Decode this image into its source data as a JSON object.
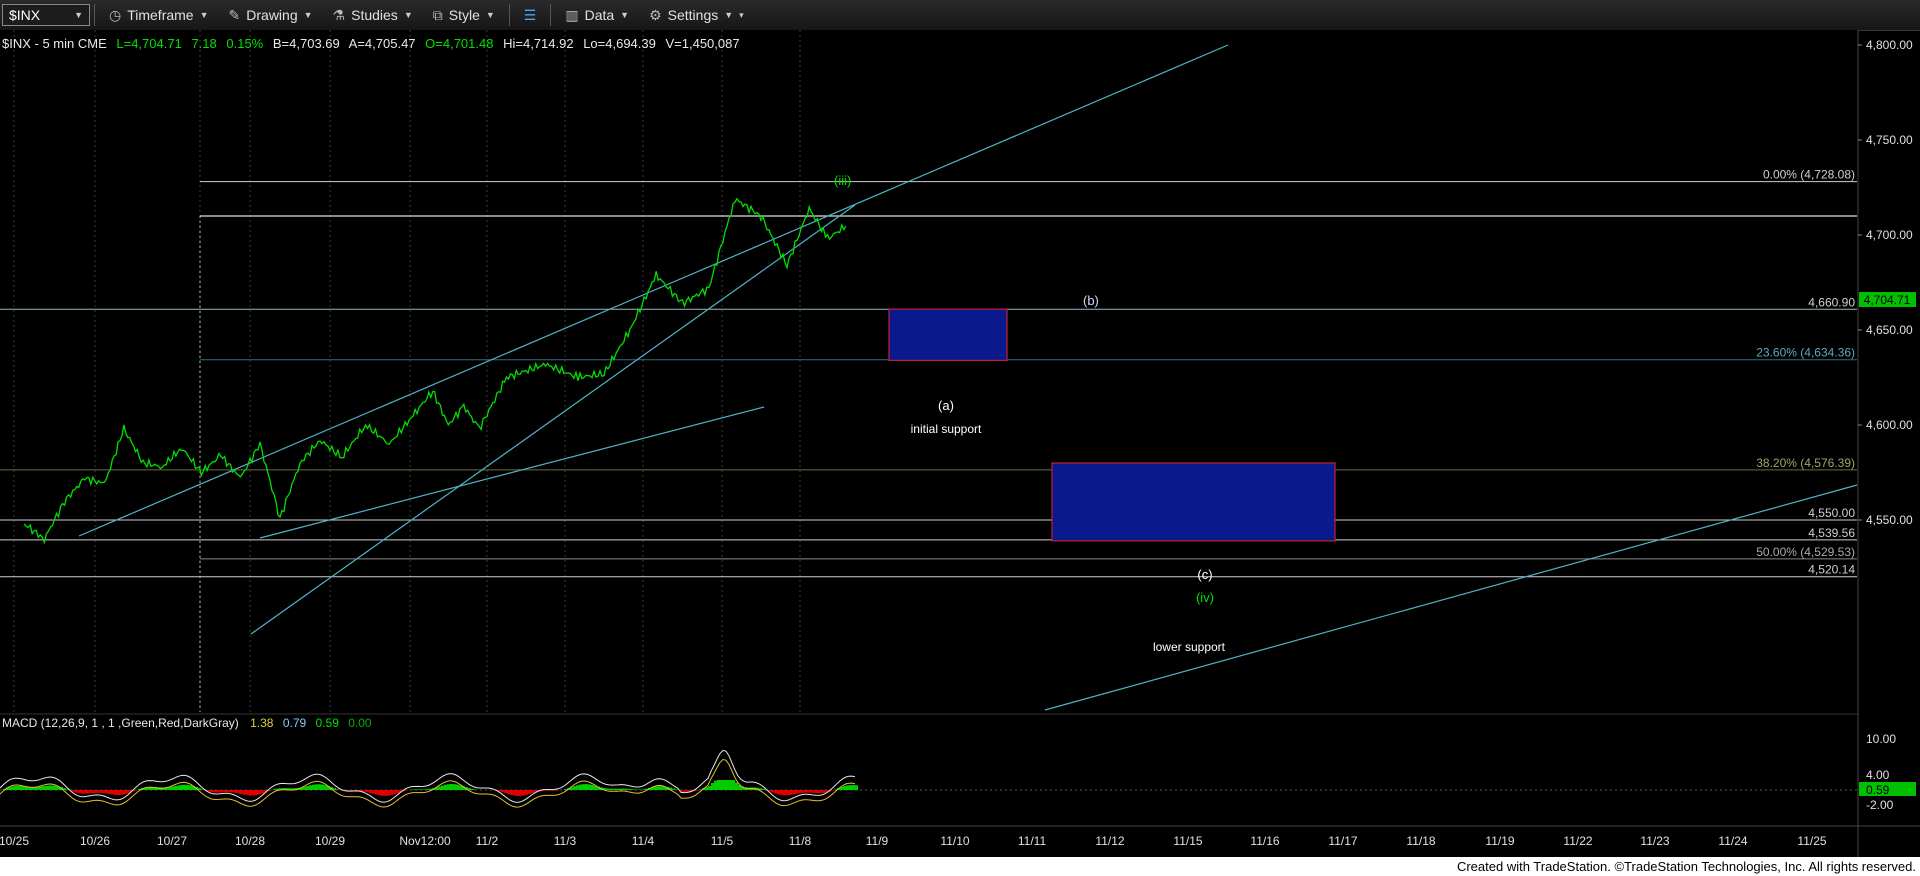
{
  "toolbar": {
    "symbol": "$INX",
    "timeframe": "Timeframe",
    "drawing": "Drawing",
    "studies": "Studies",
    "style": "Style",
    "data": "Data",
    "settings": "Settings"
  },
  "status_line": {
    "symbol": "$INX - 5 min  CME",
    "last": "L=4,704.71",
    "change": "7.18",
    "change_pct": "0.15%",
    "bid": "B=4,703.69",
    "ask": "A=4,705.47",
    "open": "O=4,701.48",
    "high": "Hi=4,714.92",
    "low": "Lo=4,694.39",
    "volume": "V=1,450,087"
  },
  "colors": {
    "price": "#00e000",
    "channel": "#4fb3c8",
    "box_fill": "#0a1a8c",
    "box_border": "#c0203a",
    "macd_up": "#00cc00",
    "macd_down": "#dd0000"
  },
  "chart_data": {
    "type": "line",
    "title": "",
    "y_axis_ticks": [
      "4,800.00",
      "4,750.00",
      "4,700.00",
      "4,650.00",
      "4,600.00",
      "4,550.00"
    ],
    "ylim": [
      4515,
      4805
    ],
    "x_axis_ticks": [
      "10/25",
      "10/26",
      "10/27",
      "10/28",
      "10/29",
      "Nov12:00",
      "11/2",
      "11/3",
      "11/4",
      "11/5",
      "11/8",
      "11/9",
      "11/10",
      "11/11",
      "11/12",
      "11/15",
      "11/16",
      "11/17",
      "11/18",
      "11/19",
      "11/22",
      "11/23",
      "11/24",
      "11/25"
    ],
    "last_price_label": "4,704.71",
    "levels": [
      {
        "label": "0.00% (4,728.08)",
        "value": 4728.08
      },
      {
        "label": "4,660.90",
        "value": 4660.9
      },
      {
        "label": "23.60% (4,634.36)",
        "value": 4634.36
      },
      {
        "label": "38.20% (4,576.39)",
        "value": 4576.39
      },
      {
        "label": "4,550.00",
        "value": 4550.0
      },
      {
        "label": "4,539.56",
        "value": 4539.56
      },
      {
        "label": "50.00% (4,529.53)",
        "value": 4529.53
      },
      {
        "label": "4,520.14",
        "value": 4520.14
      }
    ],
    "price_series": [
      {
        "x": "10/25",
        "y": 4548
      },
      {
        "x": "10/25",
        "y": 4540
      },
      {
        "x": "10/25",
        "y": 4560
      },
      {
        "x": "10/25",
        "y": 4572
      },
      {
        "x": "10/26",
        "y": 4569
      },
      {
        "x": "10/26",
        "y": 4598
      },
      {
        "x": "10/26",
        "y": 4580
      },
      {
        "x": "10/26",
        "y": 4578
      },
      {
        "x": "10/27",
        "y": 4588
      },
      {
        "x": "10/27",
        "y": 4575
      },
      {
        "x": "10/27",
        "y": 4584
      },
      {
        "x": "10/27",
        "y": 4572
      },
      {
        "x": "10/28",
        "y": 4590
      },
      {
        "x": "10/28",
        "y": 4551
      },
      {
        "x": "10/28",
        "y": 4580
      },
      {
        "x": "10/28",
        "y": 4592
      },
      {
        "x": "10/29",
        "y": 4583
      },
      {
        "x": "10/29",
        "y": 4600
      },
      {
        "x": "10/29",
        "y": 4590
      },
      {
        "x": "10/29",
        "y": 4605
      },
      {
        "x": "Nov12:00",
        "y": 4618
      },
      {
        "x": "Nov12:00",
        "y": 4600
      },
      {
        "x": "Nov12:00",
        "y": 4610
      },
      {
        "x": "Nov12:00",
        "y": 4598
      },
      {
        "x": "11/2",
        "y": 4625
      },
      {
        "x": "11/2",
        "y": 4632
      },
      {
        "x": "11/3",
        "y": 4625
      },
      {
        "x": "11/3",
        "y": 4627
      },
      {
        "x": "11/3",
        "y": 4650
      },
      {
        "x": "11/4",
        "y": 4679
      },
      {
        "x": "11/4",
        "y": 4664
      },
      {
        "x": "11/4",
        "y": 4672
      },
      {
        "x": "11/5",
        "y": 4719
      },
      {
        "x": "11/5",
        "y": 4710
      },
      {
        "x": "11/5",
        "y": 4684
      },
      {
        "x": "11/8",
        "y": 4714
      },
      {
        "x": "11/8",
        "y": 4698
      },
      {
        "x": "11/8",
        "y": 4704.71
      }
    ],
    "annotations": [
      {
        "text": "(iii)",
        "color": "#00e000"
      },
      {
        "text": "(b)",
        "color": "#cfd8ff"
      },
      {
        "text": "(a)",
        "color": "#ffffff"
      },
      {
        "text": "initial support",
        "color": "#ffffff"
      },
      {
        "text": "(c)",
        "color": "#ffffff"
      },
      {
        "text": "(iv)",
        "color": "#00e000"
      },
      {
        "text": "lower support",
        "color": "#ffffff"
      }
    ]
  },
  "macd": {
    "label": "MACD (12,26,9, 1 , 1 ,Green,Red,DarkGray)",
    "v1": "1.38",
    "v2": "0.79",
    "v3": "0.59",
    "v4": "0.00",
    "axis_ticks": [
      "10.00",
      "4.00",
      "0.59",
      "-2.00"
    ]
  },
  "footer": "Created with TradeStation. ©TradeStation Technologies, Inc. All rights reserved."
}
